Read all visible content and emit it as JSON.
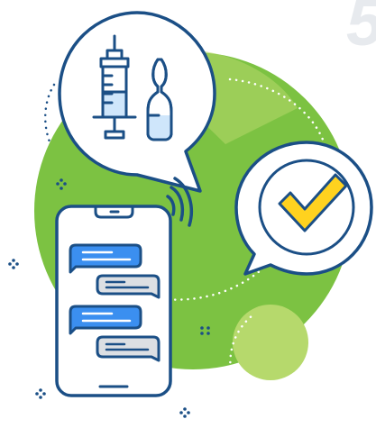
{
  "corner_numeral": "5",
  "colors": {
    "outline": "#1b4f86",
    "green_dark": "#7cc242",
    "green_light": "#b6d96c",
    "blue": "#3b8ff0",
    "blue_pale": "#cfe6fb",
    "grey_bubble": "#dcdfe3",
    "yellow": "#ffd21f",
    "white": "#ffffff"
  },
  "icons": [
    "syringe-icon",
    "ampoule-icon",
    "checkmark-icon",
    "smartphone-icon",
    "wifi-signal-icon",
    "sparkle-icon"
  ]
}
